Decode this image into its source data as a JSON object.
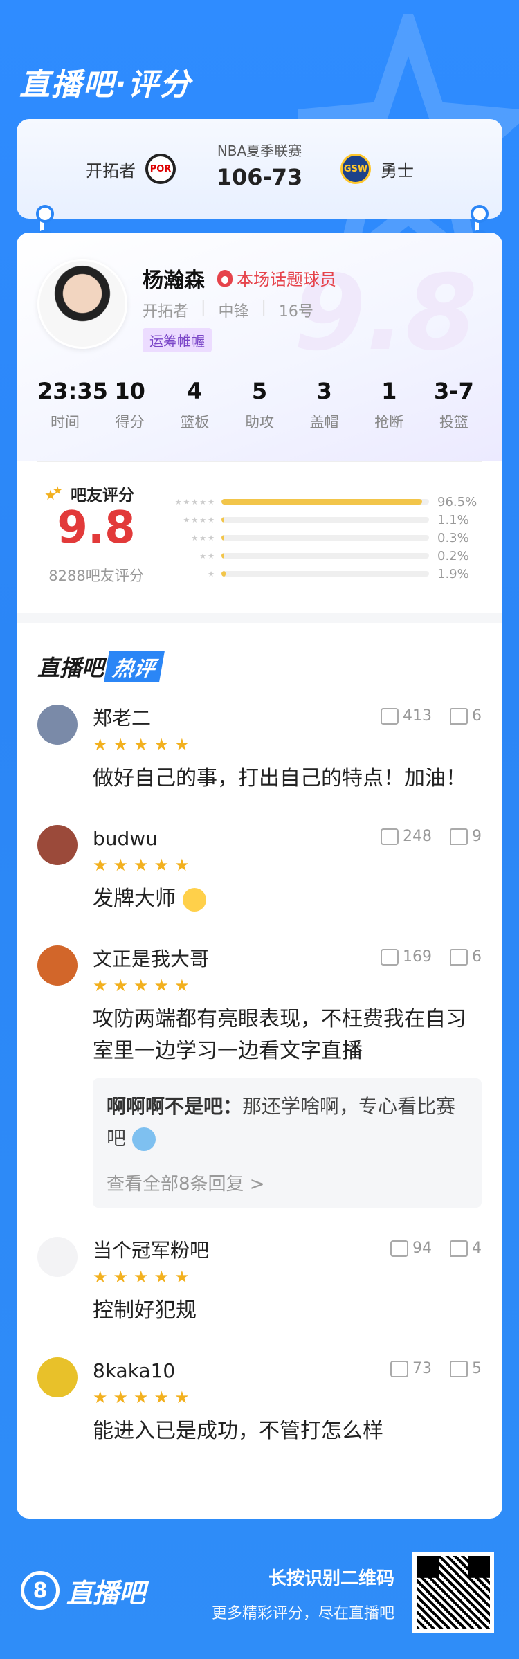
{
  "brand": {
    "title": "直播吧·评分"
  },
  "match": {
    "league": "NBA夏季联赛",
    "score": "106-73",
    "home": {
      "name": "开拓者",
      "logo_text": "POR"
    },
    "away": {
      "name": "勇士",
      "logo_text": "GSW"
    }
  },
  "player": {
    "name": "杨瀚森",
    "hot_tag": "本场话题球员",
    "team": "开拓者",
    "position": "中锋",
    "number": "16号",
    "tag": "运筹帷幄",
    "big_score": "9.8",
    "stats": [
      {
        "value": "23:35",
        "label": "时间"
      },
      {
        "value": "10",
        "label": "得分"
      },
      {
        "value": "4",
        "label": "篮板"
      },
      {
        "value": "5",
        "label": "助攻"
      },
      {
        "value": "3",
        "label": "盖帽"
      },
      {
        "value": "1",
        "label": "抢断"
      },
      {
        "value": "3-7",
        "label": "投篮"
      }
    ]
  },
  "fan_rating": {
    "title": "吧友评分",
    "score": "9.8",
    "count": "8288吧友评分",
    "distribution": [
      {
        "stars": 5,
        "pct": "96.5%",
        "value": 96.5
      },
      {
        "stars": 4,
        "pct": "1.1%",
        "value": 1.1
      },
      {
        "stars": 3,
        "pct": "0.3%",
        "value": 0.3
      },
      {
        "stars": 2,
        "pct": "0.2%",
        "value": 0.2
      },
      {
        "stars": 1,
        "pct": "1.9%",
        "value": 1.9
      }
    ]
  },
  "hot": {
    "title_prefix": "直播吧",
    "title_badge": "热评"
  },
  "comments": [
    {
      "name": "郑老二",
      "likes": "413",
      "replies": "6",
      "text": "做好自己的事，打出自己的特点！加油！",
      "stars": "★★★★★",
      "avatar_color": "#7a8aa8"
    },
    {
      "name": "budwu",
      "likes": "248",
      "replies": "9",
      "text": "发牌大师",
      "stars": "★★★★★",
      "avatar_color": "#9b4a3a"
    },
    {
      "name": "文正是我大哥",
      "likes": "169",
      "replies": "6",
      "text": "攻防两端都有亮眼表现，不枉费我在自习室里一边学习一边看文字直播",
      "stars": "★★★★★",
      "avatar_color": "#d2662a",
      "reply": {
        "user": "啊啊啊不是吧：",
        "text": "那还学啥啊，专心看比赛吧",
        "more": "查看全部8条回复 >"
      }
    },
    {
      "name": "当个冠军粉吧",
      "likes": "94",
      "replies": "4",
      "text": "控制好犯规",
      "stars": "★★★★★",
      "avatar_color": "#f3f3f5"
    },
    {
      "name": "8kaka10",
      "likes": "73",
      "replies": "5",
      "text": "能进入已是成功，不管打怎么样",
      "stars": "★★★★★",
      "avatar_color": "#e8c12a"
    }
  ],
  "footer": {
    "logo_number": "8",
    "logo_text": "直播吧",
    "line1": "长按识别二维码",
    "line2": "更多精彩评分，尽在直播吧"
  }
}
